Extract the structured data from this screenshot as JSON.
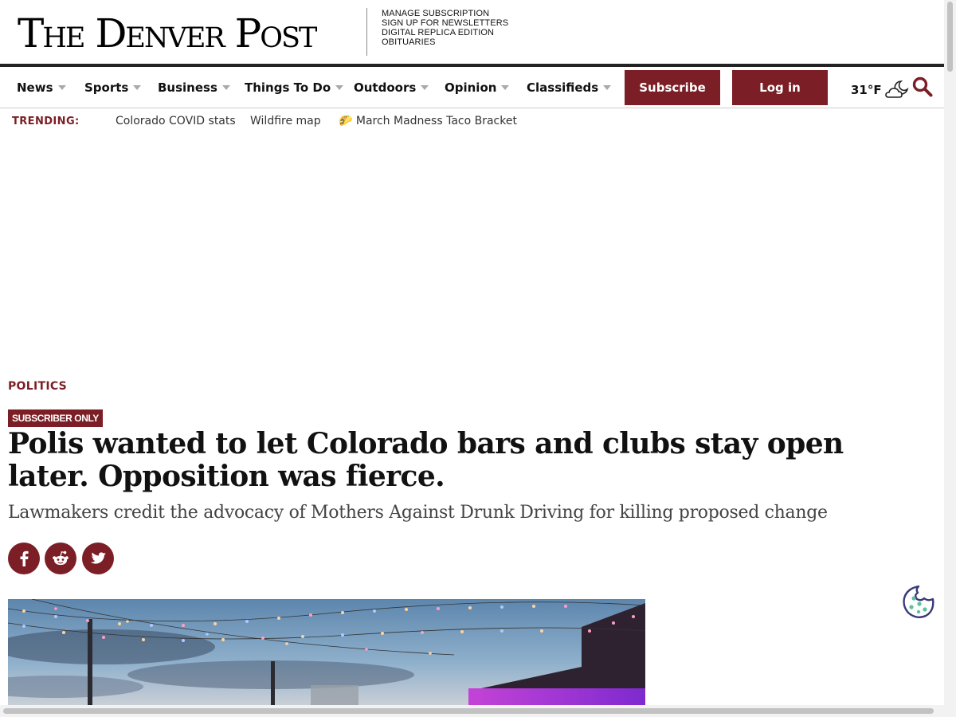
{
  "masthead": {
    "logo": "The Denver Post",
    "links": [
      "MANAGE SUBSCRIPTION",
      "SIGN UP FOR NEWSLETTERS",
      "DIGITAL REPLICA EDITION",
      "OBITUARIES"
    ]
  },
  "nav": {
    "items": [
      "News",
      "Sports",
      "Business",
      "Things To Do",
      "Outdoors",
      "Opinion",
      "Classifieds"
    ],
    "subscribe_label": "Subscribe",
    "login_label": "Log in",
    "temperature": "31°F"
  },
  "trending": {
    "label": "TRENDING:",
    "links": [
      "Colorado COVID stats",
      "Wildfire map",
      "🌮 March Madness Taco Bracket"
    ]
  },
  "article": {
    "section": "POLITICS",
    "badge": "SUBSCRIBER ONLY",
    "headline": "Polis wanted to let Colorado bars and clubs stay open later. Opposition was fierce.",
    "dek": "Lawmakers credit the advocacy of Mothers Against Drunk Driving for killing proposed change"
  },
  "colors": {
    "brand": "#7c1e25",
    "text": "#111111"
  },
  "icons": [
    "partly-cloudy-night-icon",
    "search-icon",
    "facebook-icon",
    "reddit-icon",
    "twitter-icon",
    "cookie-icon"
  ]
}
